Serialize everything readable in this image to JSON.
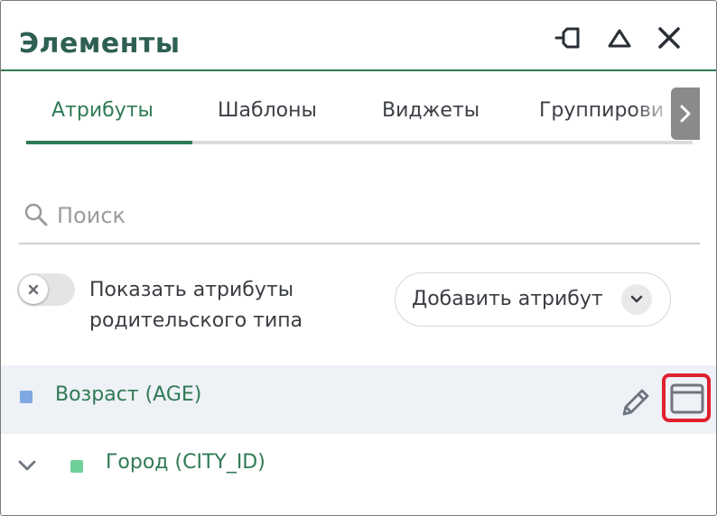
{
  "panel": {
    "title": "Элементы",
    "icons": [
      "pin-icon",
      "collapse-up-icon",
      "close-icon"
    ]
  },
  "tabs": [
    {
      "label": "Атрибуты",
      "active": true
    },
    {
      "label": "Шаблоны",
      "active": false
    },
    {
      "label": "Виджеты",
      "active": false
    },
    {
      "label": "Группирови",
      "active": false
    }
  ],
  "search": {
    "placeholder": "Поиск",
    "value": ""
  },
  "toggle": {
    "state": "off",
    "label_line1": "Показать атрибуты",
    "label_line2": "родительского типа"
  },
  "add_button": {
    "label": "Добавить атрибут"
  },
  "rows": [
    {
      "label": "Возраст (AGE)",
      "marker_color": "#7fa8e3",
      "actions": [
        "edit-icon",
        "window-icon"
      ],
      "selected": true
    },
    {
      "label": "Город (CITY_ID)",
      "marker_color": "#6fcf99",
      "expander": "chevron-down-icon"
    }
  ],
  "colors": {
    "accent": "#2f7a55",
    "highlight": "#e0202e"
  }
}
